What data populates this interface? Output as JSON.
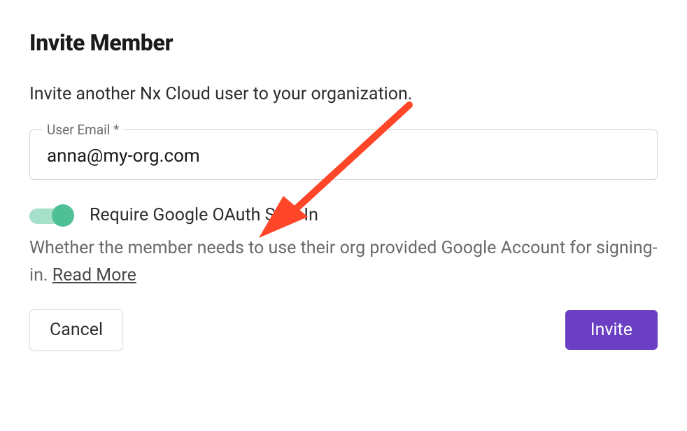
{
  "title": "Invite Member",
  "description": "Invite another Nx Cloud user to your organization.",
  "emailField": {
    "label": "User Email *",
    "value": "anna@my-org.com"
  },
  "toggle": {
    "label": "Require Google OAuth Sign-In",
    "on": true
  },
  "helperText": "Whether the member needs to use their org provided Google Account for signing-in. ",
  "readMoreLabel": "Read More",
  "actions": {
    "cancel": "Cancel",
    "invite": "Invite"
  }
}
